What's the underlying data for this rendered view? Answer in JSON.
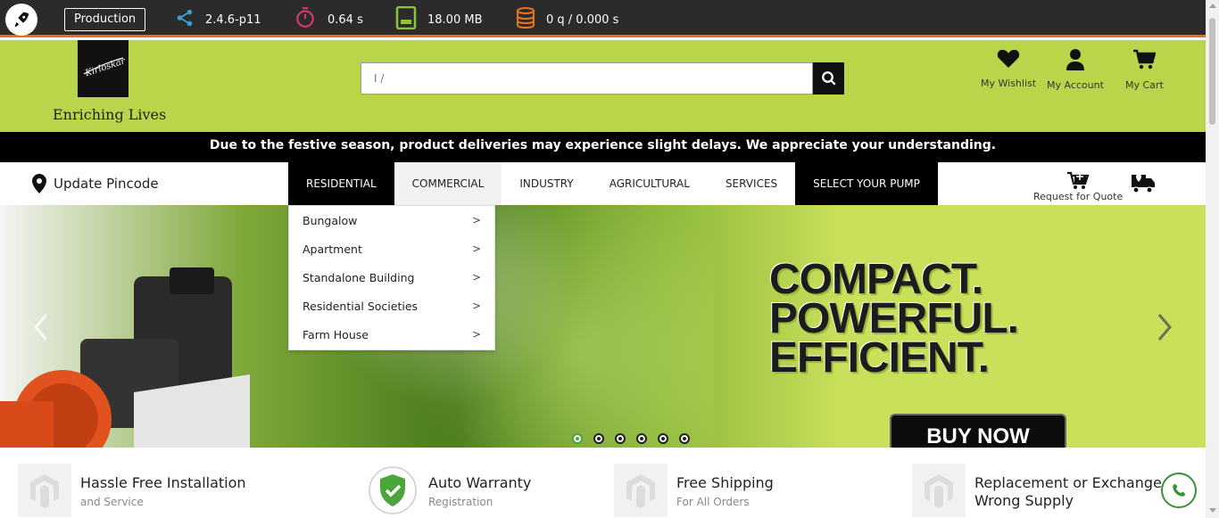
{
  "toolbar": {
    "environment": "Production",
    "version": "2.4.6-p11",
    "time": "0.64 s",
    "memory": "18.00 MB",
    "queries": "0 q / 0.000 s",
    "icons": [
      "rocket-icon",
      "share-icon",
      "stopwatch-icon",
      "memory-icon",
      "database-icon"
    ],
    "accent_color": "#e8711c"
  },
  "header": {
    "logo_text": "Kirloskar",
    "tagline": "Enriching Lives",
    "search": {
      "value": "",
      "placeholder": "I /"
    },
    "links": [
      {
        "label": "My Wishlist",
        "icon": "heart-icon"
      },
      {
        "label": "My Account",
        "icon": "user-icon"
      },
      {
        "label": "My Cart",
        "icon": "cart-icon"
      }
    ],
    "background_color": "#b9d64a"
  },
  "notice": "Due to the festive season, product deliveries may experience slight delays. We appreciate your understanding.",
  "nav": {
    "pincode_label": "Update Pincode",
    "items": [
      "RESIDENTIAL",
      "COMMERCIAL",
      "INDUSTRY",
      "AGRICULTURAL",
      "SERVICES",
      "SELECT YOUR PUMP"
    ],
    "quote_label": "Request for Quote"
  },
  "dropdown": {
    "items": [
      "Bungalow",
      "Apartment",
      "Standalone Building",
      "Residential Societies",
      "Farm House"
    ]
  },
  "hero": {
    "headline": "COMPACT.\nPOWERFUL.\nEFFICIENT.",
    "cta": "BUY NOW",
    "slide_count": 6,
    "active_slide": 1
  },
  "features": [
    {
      "title": "Hassle Free Installation",
      "subtitle": "and Service"
    },
    {
      "title": "Auto Warranty",
      "subtitle": "Registration"
    },
    {
      "title": "Free Shipping",
      "subtitle": "For All Orders"
    },
    {
      "title": "Replacement or Exchange",
      "subtitle": "Wrong Supply"
    }
  ]
}
